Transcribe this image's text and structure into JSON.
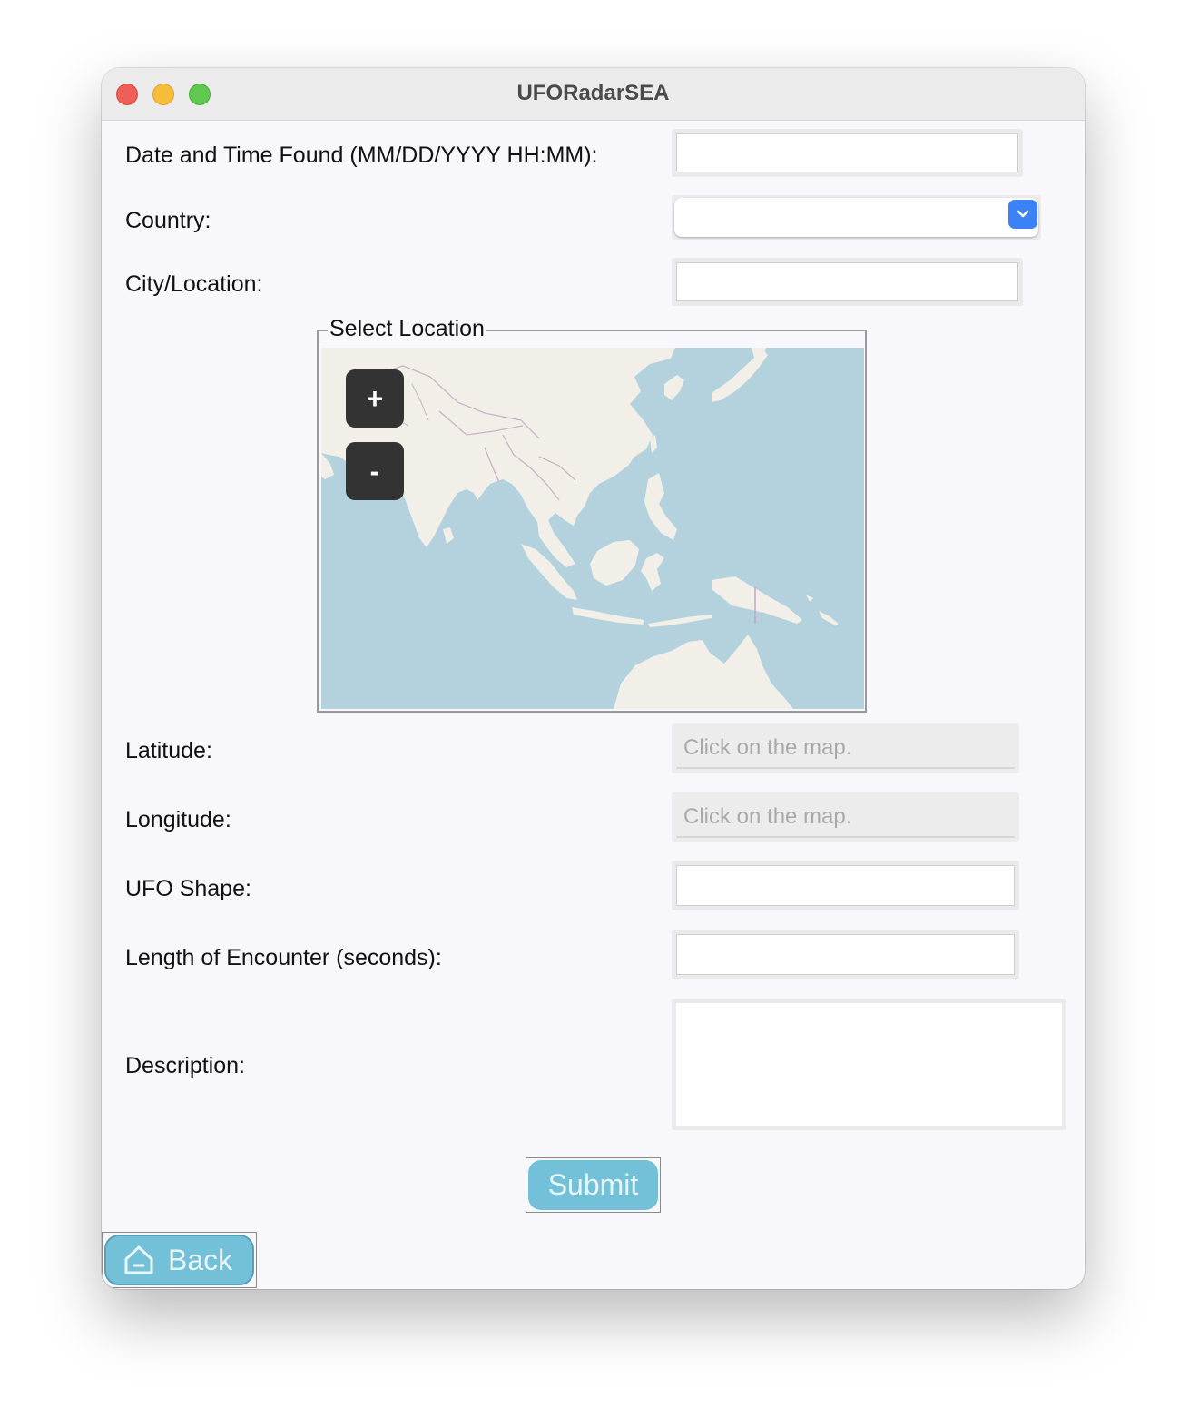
{
  "window": {
    "title": "UFORadarSEA"
  },
  "form": {
    "datetime_label": "Date and Time Found (MM/DD/YYYY HH:MM):",
    "datetime_value": "",
    "country_label": "Country:",
    "country_value": "",
    "city_label": "City/Location:",
    "city_value": "",
    "map_group_title": "Select Location",
    "zoom_in_label": "+",
    "zoom_out_label": "-",
    "latitude_label": "Latitude:",
    "latitude_placeholder": "Click on the map.",
    "longitude_label": "Longitude:",
    "longitude_placeholder": "Click on the map.",
    "shape_label": "UFO Shape:",
    "shape_value": "",
    "length_label": "Length of Encounter (seconds):",
    "length_value": "",
    "description_label": "Description:",
    "description_value": "",
    "submit_label": "Submit",
    "back_label": "Back"
  },
  "colors": {
    "accent_button": "#72c1d9",
    "combo_button": "#3b82f6",
    "water": "#b3d2dd",
    "land": "#f2efe9"
  },
  "icons": {
    "combo": "chevron-down-icon",
    "back": "home-icon"
  }
}
